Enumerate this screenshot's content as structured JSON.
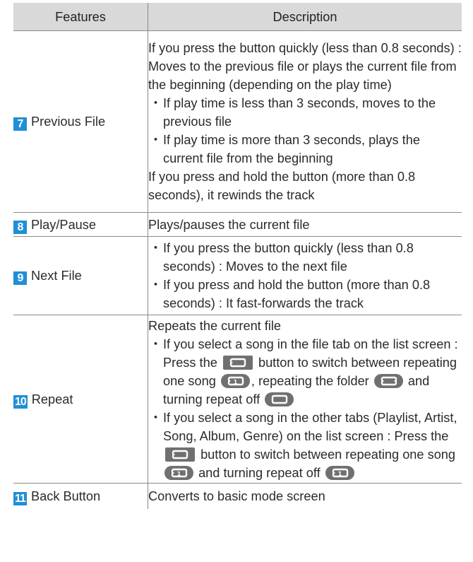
{
  "table": {
    "headers": {
      "features": "Features",
      "description": "Description"
    },
    "rows": [
      {
        "badge": "7",
        "feature": "Previous File",
        "intro": [
          "If you press the button quickly (less than 0.8 seconds) : Moves to the previous file or plays the current file from the beginning (depending on the play time)"
        ],
        "bullets": [
          "If play time is less than 3 seconds, moves to the previous file",
          "If play time is more than 3 seconds, plays the current file from the beginning"
        ],
        "outro": "If you press and hold the button (more than 0.8 seconds), it rewinds the track"
      },
      {
        "badge": "8",
        "feature": "Play/Pause",
        "text": "Plays/pauses the current file"
      },
      {
        "badge": "9",
        "feature": "Next File",
        "bullets": [
          "If you press the button quickly (less than 0.8 seconds) : Moves to the next file",
          "If you press and hold the button (more than 0.8 seconds) : It fast-forwards the track"
        ]
      },
      {
        "badge": "10",
        "feature": "Repeat",
        "intro": "Repeats the current file",
        "bullet1": {
          "a": "If you select a song in the file tab on the list screen : Press the",
          "b": "button to switch between repeating one song",
          "c": ", repeating the folder",
          "d": "and turning repeat off"
        },
        "bullet2": {
          "a": "If you select a song in the other tabs (Playlist, Artist, Song, Album, Genre) on the list screen : Press the",
          "b": "button to switch between repeating one song",
          "c": "and turning repeat off"
        }
      },
      {
        "badge": "11",
        "feature": "Back Button",
        "text": "Converts to basic mode screen"
      }
    ],
    "bullet_glyph": "・"
  },
  "icons": {
    "repeat_button": "repeat-button-icon",
    "repeat_one": "repeat-one-icon",
    "repeat_folder": "repeat-folder-icon",
    "repeat_off": "repeat-off-icon"
  },
  "colors": {
    "header_bg": "#d9d9d9",
    "badge_bg": "#1f8fd6",
    "icon_bg": "#707070",
    "rule": "#8a8a8a"
  }
}
